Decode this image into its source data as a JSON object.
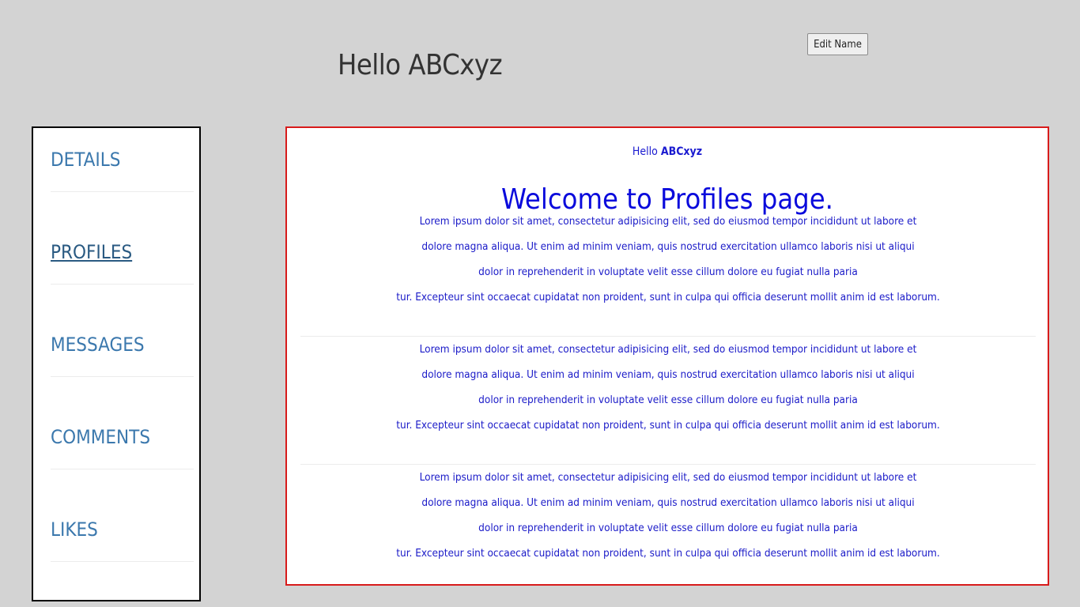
{
  "header": {
    "greeting": "Hello ABCxyz",
    "edit_button_label": "Edit Name"
  },
  "sidebar": {
    "items": [
      {
        "label": "DETAILS",
        "active": false
      },
      {
        "label": "PROFILES",
        "active": true
      },
      {
        "label": "MESSAGES",
        "active": false
      },
      {
        "label": "COMMENTS",
        "active": false
      },
      {
        "label": "LIKES",
        "active": false
      }
    ]
  },
  "content": {
    "hello_prefix": "Hello",
    "hello_name": "ABCxyz",
    "title": "Welcome to Profiles page.",
    "paragraphs": [
      {
        "lines": [
          "Lorem ipsum dolor sit amet, consectetur adipisicing elit, sed do eiusmod tempor incididunt ut labore et",
          "dolore magna aliqua. Ut enim ad minim veniam, quis nostrud exercitation ullamco laboris nisi ut aliqui",
          "dolor in reprehenderit in voluptate velit esse cillum dolore eu fugiat nulla paria",
          "tur. Excepteur sint occaecat cupidatat non proident, sunt in culpa qui officia deserunt mollit anim id est laborum."
        ]
      },
      {
        "lines": [
          "Lorem ipsum dolor sit amet, consectetur adipisicing elit, sed do eiusmod tempor incididunt ut labore et",
          "dolore magna aliqua. Ut enim ad minim veniam, quis nostrud exercitation ullamco laboris nisi ut aliqui",
          "dolor in reprehenderit in voluptate velit esse cillum dolore eu fugiat nulla paria",
          "tur. Excepteur sint occaecat cupidatat non proident, sunt in culpa qui officia deserunt mollit anim id est laborum."
        ]
      },
      {
        "lines": [
          "Lorem ipsum dolor sit amet, consectetur adipisicing elit, sed do eiusmod tempor incididunt ut labore et",
          "dolore magna aliqua. Ut enim ad minim veniam, quis nostrud exercitation ullamco laboris nisi ut aliqui",
          "dolor in reprehenderit in voluptate velit esse cillum dolore eu fugiat nulla paria",
          "tur. Excepteur sint occaecat cupidatat non proident, sunt in culpa qui officia deserunt mollit anim id est laborum."
        ]
      }
    ]
  },
  "colors": {
    "page_background": "#d3d3d3",
    "nav_link": "#3b78ad",
    "content_border": "#d81b1b",
    "content_text": "#0a0adc"
  }
}
